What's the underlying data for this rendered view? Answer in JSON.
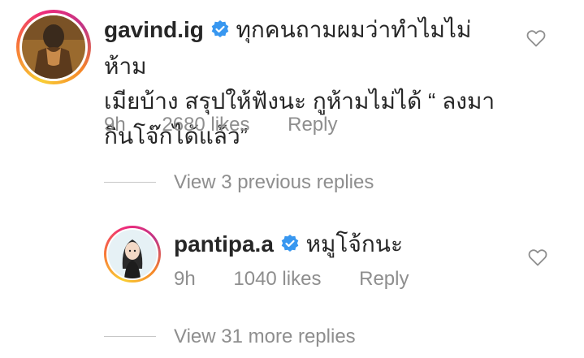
{
  "comment": {
    "username": "gavind.ig",
    "text_line1": "ทุกคนถามผมว่าทำไมไม่ห้าม",
    "text_line2": "เมียบ้าง สรุปให้ฟังนะ กูห้ามไม่ได้ “ ลงมา",
    "text_line3": "กินโจ๊กได้แล้ว”",
    "time": "9h",
    "likes": "2680 likes",
    "reply_label": "Reply"
  },
  "view_previous": "View 3 previous replies",
  "reply": {
    "username": "pantipa.a",
    "text": "หมูโจ้กนะ",
    "time": "9h",
    "likes": "1040 likes",
    "reply_label": "Reply"
  },
  "view_more": "View 31 more replies",
  "colors": {
    "text": "#262626",
    "secondary": "#8e8e8e",
    "verified": "#3897f0",
    "divider": "#c7c7c7"
  }
}
